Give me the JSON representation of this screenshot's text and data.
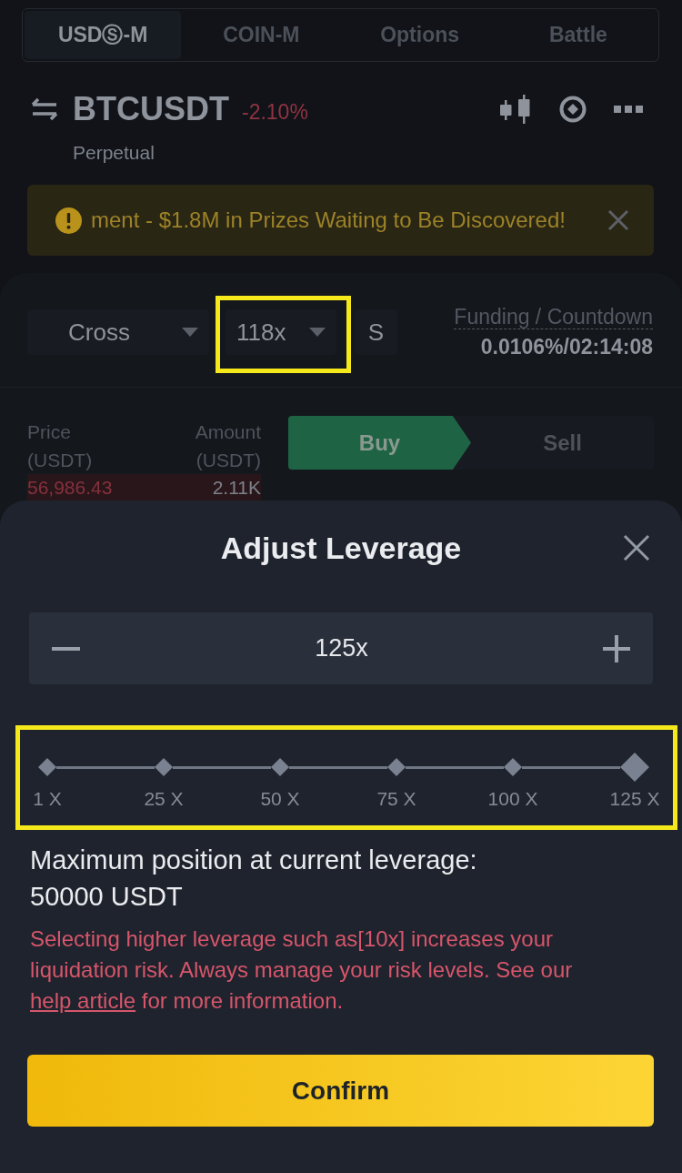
{
  "tabs": [
    {
      "label": "USDⓈ-M",
      "selected": true
    },
    {
      "label": "COIN-M",
      "selected": false
    },
    {
      "label": "Options",
      "selected": false
    },
    {
      "label": "Battle",
      "selected": false
    }
  ],
  "market": {
    "symbol": "BTCUSDT",
    "change": "-2.10%",
    "type": "Perpetual"
  },
  "banner": {
    "text": "ment - $1.8M in Prizes Waiting to Be Discovered!"
  },
  "controls": {
    "margin_mode": "Cross",
    "leverage": {
      "value": "118x",
      "highlighted": true
    },
    "size_button": "S",
    "funding_label": "Funding / Countdown",
    "funding_value": "0.0106%/02:14:08"
  },
  "order_book": {
    "columns": [
      {
        "title": "Price",
        "unit": "(USDT)"
      },
      {
        "title": "Amount",
        "unit": "(USDT)"
      }
    ],
    "rows": [
      {
        "price": "56,986.43",
        "amount": "2.11K"
      }
    ]
  },
  "order_side": [
    {
      "label": "Buy",
      "selected": true
    },
    {
      "label": "Sell",
      "selected": false
    }
  ],
  "dialog": {
    "title": "Adjust Leverage",
    "stepper": {
      "value": "125x"
    },
    "slider": {
      "highlighted": true,
      "marks": [
        {
          "label": "1 X",
          "selected": false
        },
        {
          "label": "25 X",
          "selected": false
        },
        {
          "label": "50 X",
          "selected": false
        },
        {
          "label": "75 X",
          "selected": false
        },
        {
          "label": "100 X",
          "selected": false
        },
        {
          "label": "125 X",
          "selected": true
        }
      ]
    },
    "max_position_label": "Maximum position at current leverage:",
    "max_position_value": "50000 USDT",
    "warning": {
      "text": "Selecting higher leverage such as[10x] increases your liquidation risk. Always manage your risk levels. See our",
      "link": "help article",
      "text_after": "for more information."
    },
    "confirm_button": "Confirm"
  }
}
